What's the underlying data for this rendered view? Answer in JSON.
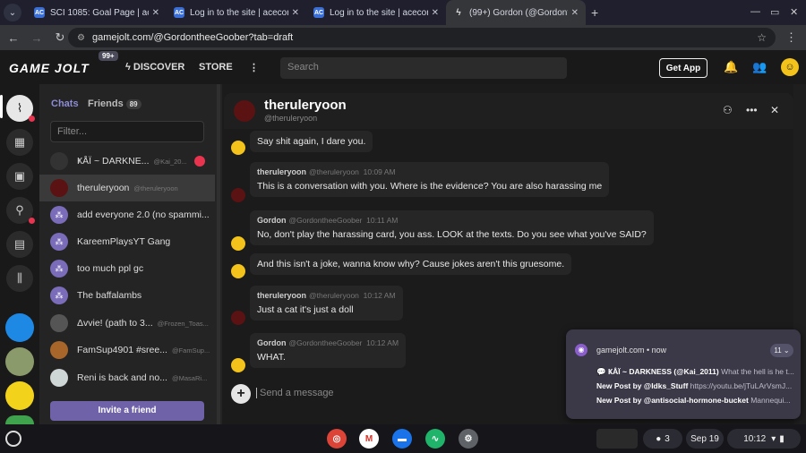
{
  "browser": {
    "tabs": [
      {
        "favicon": "AC",
        "title": "SCI 1085: Goal Page | aceconn"
      },
      {
        "favicon": "AC",
        "title": "Log in to the site | aceconnect"
      },
      {
        "favicon": "AC",
        "title": "Log in to the site | aceconnect"
      },
      {
        "favicon": "GJ",
        "title": "(99+) Gordon (@GordontheeGo"
      }
    ],
    "url": "gamejolt.com/@GordontheeGoober?tab=draft",
    "new_tab": "+"
  },
  "gj_header": {
    "logo": "GAME JOLT",
    "logo_badge": "99+",
    "discover": "DISCOVER",
    "store": "STORE",
    "search_placeholder": "Search",
    "get_app": "Get App"
  },
  "sidebar": {
    "tab_chats": "Chats",
    "tab_friends": "Friends",
    "friends_count": "89",
    "filter_placeholder": "Filter...",
    "invite": "Invite a friend",
    "items": [
      {
        "name": "ҜÅÏ ~ DARKNE...",
        "handle": "@Kai_20...",
        "unread": true
      },
      {
        "name": "theruleryoon",
        "handle": "@theruleryoon",
        "active": true
      },
      {
        "name": "add everyone 2.0 (no spammi...",
        "handle": ""
      },
      {
        "name": "KareemPlaysYT Gang",
        "handle": ""
      },
      {
        "name": "too much ppl gc",
        "handle": ""
      },
      {
        "name": "The baffalambs",
        "handle": ""
      },
      {
        "name": "Δvvie! (path to 3...",
        "handle": "@Frozen_Toas..."
      },
      {
        "name": "FamSup4901 #sree...",
        "handle": "@FamSup..."
      },
      {
        "name": "Reni is back and no...",
        "handle": "@MasaRi..."
      }
    ]
  },
  "chat": {
    "title": "theruleryoon",
    "handle": "@theruleryoon",
    "messages": [
      {
        "author": "",
        "handle": "",
        "time": "",
        "text": "Say shit again, I dare you."
      },
      {
        "author": "theruleryoon",
        "handle": "@theruleryoon",
        "time": "10:09 AM",
        "text": "This is a conversation with you. Where is the evidence? You are also harassing me"
      },
      {
        "author": "Gordon",
        "handle": "@GordontheeGoober",
        "time": "10:11 AM",
        "text": "No, don't play the harassing card, you ass. LOOK at the texts. Do you see what you've SAID?"
      },
      {
        "author": "",
        "handle": "",
        "time": "",
        "text": "And this isn't a joke, wanna know why? Cause jokes aren't this gruesome."
      },
      {
        "author": "theruleryoon",
        "handle": "@theruleryoon",
        "time": "10:12 AM",
        "text": "Just a cat it's just a doll"
      },
      {
        "author": "Gordon",
        "handle": "@GordontheeGoober",
        "time": "10:12 AM",
        "text": "WHAT."
      }
    ],
    "composer_placeholder": "Send a message"
  },
  "notification": {
    "source": "gamejolt.com • now",
    "count": "11",
    "lines": [
      {
        "bold": "💬 ҜÅÏ ~ DARKNESS (@Kai_2011)",
        "rest": "What the hell is he t..."
      },
      {
        "bold": "New Post by @Idks_Stuff",
        "rest": "https://youtu.be/jTuLArVsmJ..."
      },
      {
        "bold": "New Post by @antisocial-hormone-bucket",
        "rest": "Mannequi..."
      }
    ]
  },
  "shelf": {
    "notif_count": "3",
    "date": "Sep 19",
    "time": "10:12"
  }
}
